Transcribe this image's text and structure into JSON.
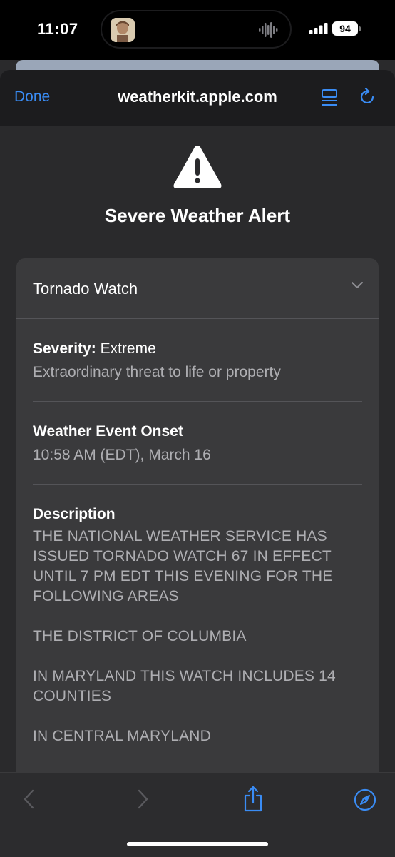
{
  "status": {
    "time": "11:07",
    "battery": "94"
  },
  "browser": {
    "done_label": "Done",
    "url": "weatherkit.apple.com",
    "accent": "#3a8cf4"
  },
  "alert": {
    "title": "Severe Weather Alert",
    "event_name": "Tornado Watch",
    "severity_label": "Severity:",
    "severity_value": "Extreme",
    "severity_desc": "Extraordinary threat to life or property",
    "onset_label": "Weather Event Onset",
    "onset_value": "10:58 AM (EDT), March 16",
    "description_label": "Description",
    "description_paragraphs": [
      "THE NATIONAL WEATHER SERVICE HAS ISSUED TORNADO WATCH 67 IN EFFECT UNTIL 7 PM EDT THIS EVENING FOR THE FOLLOWING AREAS",
      "THE DISTRICT OF COLUMBIA",
      "IN MARYLAND THIS WATCH INCLUDES 14 COUNTIES",
      "IN CENTRAL MARYLAND"
    ]
  },
  "icons": {
    "alert": "warning-triangle-icon",
    "reader": "reader-mode-icon",
    "reload": "reload-icon",
    "back": "chevron-left-icon",
    "forward": "chevron-right-icon",
    "share": "share-icon",
    "safari": "compass-icon"
  }
}
